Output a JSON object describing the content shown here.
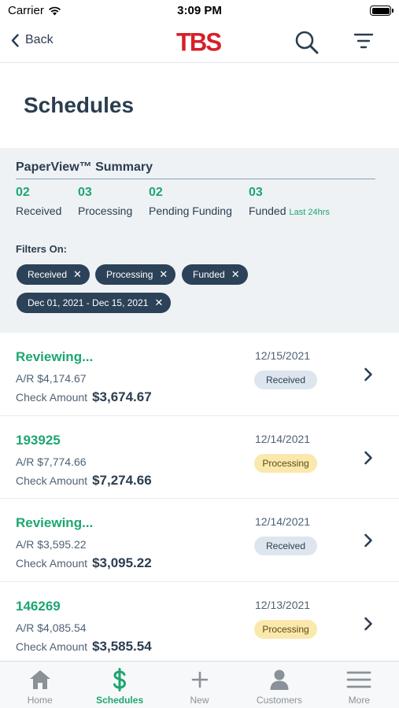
{
  "status_bar": {
    "carrier": "Carrier",
    "time": "3:09 PM"
  },
  "nav": {
    "back_label": "Back",
    "logo_text": "TBS"
  },
  "page_title": "Schedules",
  "summary": {
    "title": "PaperView™ Summary",
    "stats": [
      {
        "count": "02",
        "label": "Received"
      },
      {
        "count": "03",
        "label": "Processing"
      },
      {
        "count": "02",
        "label": "Pending Funding"
      },
      {
        "count": "03",
        "label": "Funded",
        "note": "Last 24hrs"
      }
    ],
    "filters_label": "Filters On:",
    "filters": [
      "Received",
      "Processing",
      "Funded",
      "Dec 01, 2021 - Dec 15, 2021"
    ]
  },
  "schedules": [
    {
      "title": "Reviewing...",
      "ar": "A/R $4,174.67",
      "check_label": "Check Amount",
      "check_amount": "$3,674.67",
      "date": "12/15/2021",
      "status": "Received"
    },
    {
      "title": "193925",
      "ar": "A/R $7,774.66",
      "check_label": "Check Amount",
      "check_amount": "$7,274.66",
      "date": "12/14/2021",
      "status": "Processing"
    },
    {
      "title": "Reviewing...",
      "ar": "A/R $3,595.22",
      "check_label": "Check Amount",
      "check_amount": "$3,095.22",
      "date": "12/14/2021",
      "status": "Received"
    },
    {
      "title": "146269",
      "ar": "A/R $4,085.54",
      "check_label": "Check Amount",
      "check_amount": "$3,585.54",
      "date": "12/13/2021",
      "status": "Processing"
    }
  ],
  "tabs": [
    {
      "label": "Home",
      "icon": "home-icon"
    },
    {
      "label": "Schedules",
      "icon": "dollar-icon",
      "active": true
    },
    {
      "label": "New",
      "icon": "plus-icon"
    },
    {
      "label": "Customers",
      "icon": "person-icon"
    },
    {
      "label": "More",
      "icon": "menu-icon"
    }
  ],
  "colors": {
    "accent": "#1ea672",
    "brand": "#d6202a",
    "navy": "#2c4259",
    "received_badge": "#dde6ee",
    "processing_badge": "#fbe8ad"
  }
}
